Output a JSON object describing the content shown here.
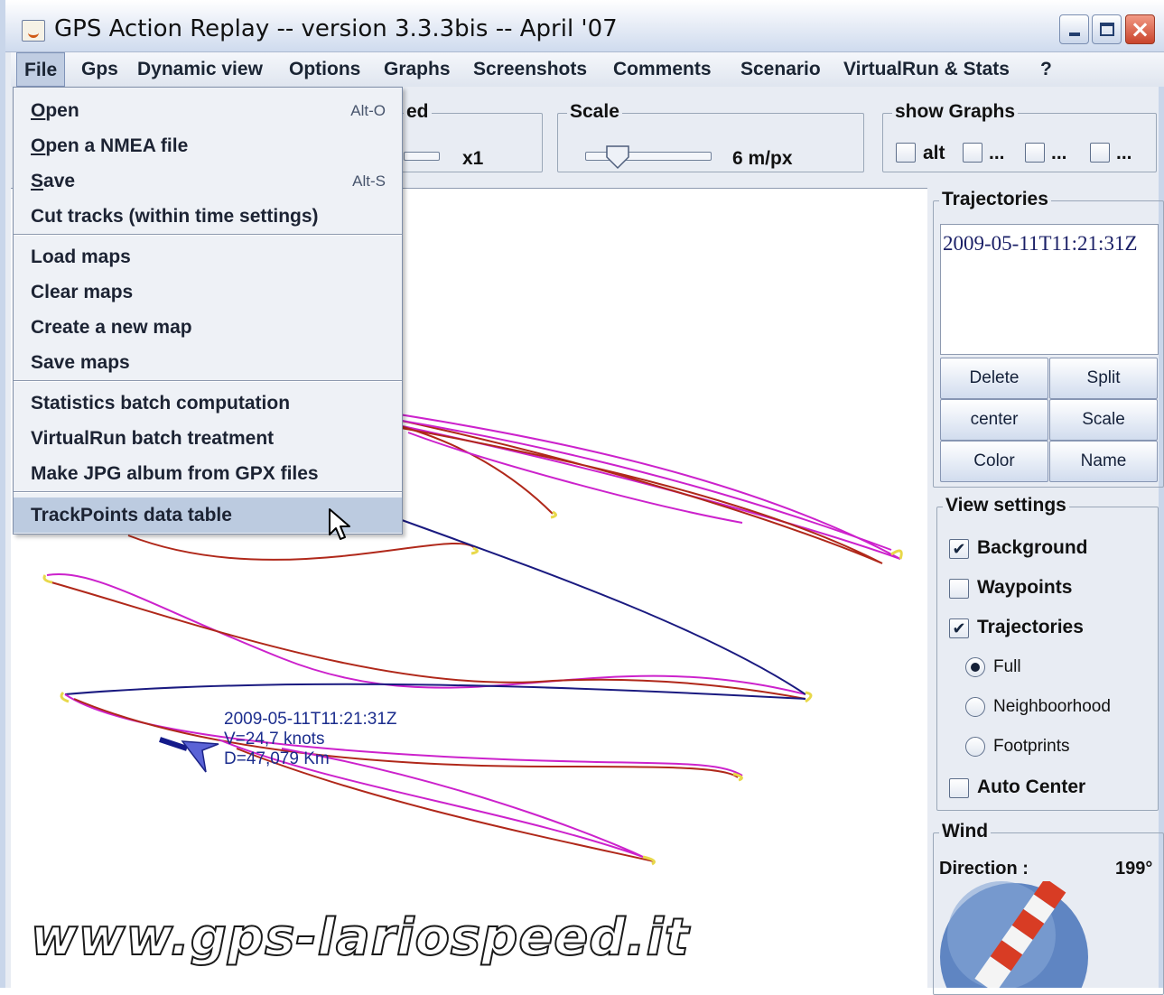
{
  "window": {
    "title": "GPS Action Replay -- version 3.3.3bis -- April '07"
  },
  "menubar": {
    "items": [
      "File",
      "Gps",
      "Dynamic view",
      "Options",
      "Graphs",
      "Screenshots",
      "Comments",
      "Scenario",
      "VirtualRun & Stats",
      "?"
    ],
    "active": "File"
  },
  "file_menu": {
    "items": [
      {
        "mn": "O",
        "rest": "pen",
        "shortcut": "Alt-O"
      },
      {
        "mn": "O",
        "rest": "pen a NMEA file",
        "shortcut": ""
      },
      {
        "mn": "S",
        "rest": "ave",
        "shortcut": "Alt-S"
      },
      {
        "label": "Cut tracks (within time settings)"
      },
      {
        "label": "Load maps"
      },
      {
        "label": "Clear maps"
      },
      {
        "label": "Create a new map"
      },
      {
        "label": "Save maps"
      },
      {
        "label": "Statistics batch computation"
      },
      {
        "label": "VirtualRun batch treatment"
      },
      {
        "label": "Make JPG album from GPX files"
      },
      {
        "label": "TrackPoints data table"
      }
    ],
    "hovered": "TrackPoints data table"
  },
  "speed_panel": {
    "legend_tail": "ed",
    "value": "x1"
  },
  "scale_panel": {
    "legend": "Scale",
    "value": "6 m/px"
  },
  "graphs_panel": {
    "legend": "show Graphs",
    "checkboxes": [
      {
        "label": "alt",
        "checked": false
      },
      {
        "label": "...",
        "checked": false
      },
      {
        "label": "...",
        "checked": false
      },
      {
        "label": "...",
        "checked": false
      }
    ]
  },
  "trajectories_panel": {
    "legend": "Trajectories",
    "list": [
      "2009-05-11T11:21:31Z"
    ],
    "buttons": [
      "Delete",
      "Split",
      "center",
      "Scale",
      "Color",
      "Name"
    ]
  },
  "view_settings": {
    "legend": "View settings",
    "background": {
      "label": "Background",
      "checked": true
    },
    "waypoints": {
      "label": "Waypoints",
      "checked": false
    },
    "trajectories": {
      "label": "Trajectories",
      "checked": true
    },
    "modes": [
      {
        "label": "Full",
        "selected": true
      },
      {
        "label": "Neighboorhood",
        "selected": false
      },
      {
        "label": "Footprints",
        "selected": false
      }
    ],
    "auto_center": {
      "label": "Auto Center",
      "checked": false
    }
  },
  "wind": {
    "legend": "Wind",
    "direction_label": "Direction :",
    "direction_value": "199°"
  },
  "map": {
    "marker_lines": [
      "2009-05-11T11:21:31Z",
      "V=24,7 knots",
      "D=47,079 Km"
    ],
    "watermark": "www.gps-lariospeed.it",
    "colors": {
      "track_a": "#cc22cc",
      "track_b": "#b0281a",
      "track_c": "#1a1a80",
      "turn": "#e8d84a"
    }
  },
  "glyphs": {
    "checked": "✔",
    "close": "×"
  }
}
